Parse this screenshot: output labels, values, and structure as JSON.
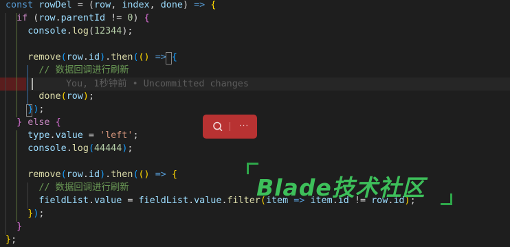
{
  "editor": {
    "colors": {
      "background": "#1e1e1e",
      "keyword": "#569cd6",
      "control": "#c586c0",
      "variable": "#9cdcfe",
      "function": "#dcdcaa",
      "number": "#b5cea8",
      "string": "#ce9178",
      "comment": "#6a9955",
      "bracket_gold": "#ffd700",
      "bracket_pink": "#da70d6",
      "bracket_blue": "#179fff",
      "text": "#d4d4d4"
    },
    "lines": [
      [
        [
          "const ",
          "k"
        ],
        [
          "rowDel",
          "v"
        ],
        [
          " = (",
          "t"
        ],
        [
          "row",
          "v"
        ],
        [
          ", ",
          "t"
        ],
        [
          "index",
          "v"
        ],
        [
          ", ",
          "t"
        ],
        [
          "done",
          "v"
        ],
        [
          ") ",
          "t"
        ],
        [
          "=>",
          "k"
        ],
        [
          " ",
          "t"
        ],
        [
          "{",
          "b1"
        ]
      ],
      [
        [
          "  ",
          "t"
        ],
        [
          "if",
          "c"
        ],
        [
          " (",
          "t"
        ],
        [
          "row",
          "v"
        ],
        [
          ".",
          "t"
        ],
        [
          "parentId",
          "v"
        ],
        [
          " != ",
          "t"
        ],
        [
          "0",
          "n"
        ],
        [
          ") ",
          "t"
        ],
        [
          "{",
          "b2"
        ]
      ],
      [
        [
          "    ",
          "t"
        ],
        [
          "console",
          "v"
        ],
        [
          ".",
          "t"
        ],
        [
          "log",
          "f"
        ],
        [
          "(",
          "t"
        ],
        [
          "12344",
          "n"
        ],
        [
          ");",
          "t"
        ]
      ],
      [
        [
          "",
          "t"
        ]
      ],
      [
        [
          "    ",
          "t"
        ],
        [
          "remove",
          "f"
        ],
        [
          "(",
          "b3"
        ],
        [
          "row",
          "v"
        ],
        [
          ".",
          "t"
        ],
        [
          "id",
          "v"
        ],
        [
          ")",
          "b3"
        ],
        [
          ".",
          "t"
        ],
        [
          "then",
          "f"
        ],
        [
          "(",
          "b3"
        ],
        [
          "()",
          "b1"
        ],
        [
          " ",
          "t"
        ],
        [
          "=>",
          "k"
        ],
        [
          " ",
          "t"
        ],
        [
          "{",
          "b3"
        ]
      ],
      [
        [
          "      ",
          "t"
        ],
        [
          "// 数据回调进行刷新",
          "cm"
        ]
      ],
      [
        [
          "",
          "t"
        ]
      ],
      [
        [
          "      ",
          "t"
        ],
        [
          "done",
          "f"
        ],
        [
          "(",
          "b1"
        ],
        [
          "row",
          "v"
        ],
        [
          ")",
          "b1"
        ],
        [
          ";",
          "t"
        ]
      ],
      [
        [
          "    ",
          "t"
        ],
        [
          "}",
          "b3"
        ],
        [
          ")",
          "b3"
        ],
        [
          ";",
          "t"
        ]
      ],
      [
        [
          "  ",
          "t"
        ],
        [
          "}",
          "b2"
        ],
        [
          " ",
          "t"
        ],
        [
          "else",
          "c"
        ],
        [
          " ",
          "t"
        ],
        [
          "{",
          "b2"
        ]
      ],
      [
        [
          "    ",
          "t"
        ],
        [
          "type",
          "v"
        ],
        [
          ".",
          "t"
        ],
        [
          "value",
          "v"
        ],
        [
          " = ",
          "t"
        ],
        [
          "'left'",
          "s"
        ],
        [
          ";",
          "t"
        ]
      ],
      [
        [
          "    ",
          "t"
        ],
        [
          "console",
          "v"
        ],
        [
          ".",
          "t"
        ],
        [
          "log",
          "f"
        ],
        [
          "(",
          "b3"
        ],
        [
          "44444",
          "n"
        ],
        [
          ")",
          "b3"
        ],
        [
          ";",
          "t"
        ]
      ],
      [
        [
          "",
          "t"
        ]
      ],
      [
        [
          "    ",
          "t"
        ],
        [
          "remove",
          "f"
        ],
        [
          "(",
          "b3"
        ],
        [
          "row",
          "v"
        ],
        [
          ".",
          "t"
        ],
        [
          "id",
          "v"
        ],
        [
          ")",
          "b3"
        ],
        [
          ".",
          "t"
        ],
        [
          "then",
          "f"
        ],
        [
          "(",
          "b3"
        ],
        [
          "()",
          "b1"
        ],
        [
          " ",
          "t"
        ],
        [
          "=>",
          "k"
        ],
        [
          " ",
          "t"
        ],
        [
          "{",
          "b1"
        ]
      ],
      [
        [
          "      ",
          "t"
        ],
        [
          "// 数据回调进行刷新",
          "cm"
        ]
      ],
      [
        [
          "      ",
          "t"
        ],
        [
          "fieldList",
          "v"
        ],
        [
          ".",
          "t"
        ],
        [
          "value",
          "v"
        ],
        [
          " = ",
          "t"
        ],
        [
          "fieldList",
          "v"
        ],
        [
          ".",
          "t"
        ],
        [
          "value",
          "v"
        ],
        [
          ".",
          "t"
        ],
        [
          "filter",
          "f"
        ],
        [
          "(",
          "b1"
        ],
        [
          "item",
          "v"
        ],
        [
          " ",
          "t"
        ],
        [
          "=>",
          "k"
        ],
        [
          " ",
          "t"
        ],
        [
          "item",
          "v"
        ],
        [
          ".",
          "t"
        ],
        [
          "id",
          "v"
        ],
        [
          " != ",
          "t"
        ],
        [
          "row",
          "v"
        ],
        [
          ".",
          "t"
        ],
        [
          "id",
          "v"
        ],
        [
          ")",
          "b1"
        ],
        [
          ";",
          "t"
        ]
      ],
      [
        [
          "    ",
          "t"
        ],
        [
          "}",
          "b1"
        ],
        [
          ")",
          "b3"
        ],
        [
          ";",
          "t"
        ]
      ],
      [
        [
          "  ",
          "t"
        ],
        [
          "}",
          "b2"
        ]
      ],
      [
        [
          "}",
          "b1"
        ],
        [
          ";",
          "t"
        ]
      ]
    ],
    "blame": "You, 1秒钟前 • Uncommitted changes"
  },
  "find_widget": {
    "search_icon": "search-icon",
    "more_label": "···"
  },
  "watermark": {
    "text": "Blade技术社区"
  }
}
